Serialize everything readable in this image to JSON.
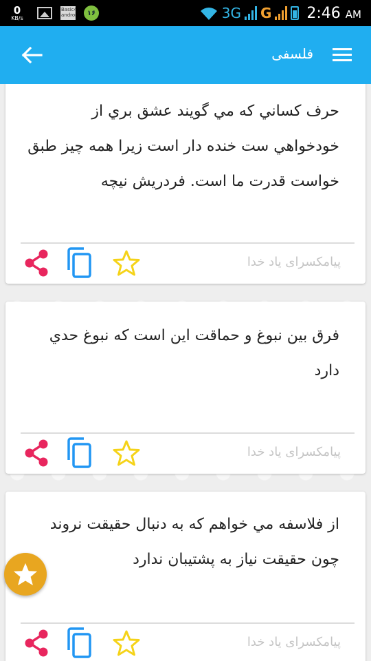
{
  "status_bar": {
    "net_speed_value": "0",
    "net_speed_unit": "KB/s",
    "app_icon_text": "Basic4 android",
    "notification_badge": "۱۶",
    "network_type_1": "3G",
    "network_type_2": "G",
    "time": "2:46",
    "ampm": "AM"
  },
  "app_bar": {
    "title": "فلسفی"
  },
  "colors": {
    "app_bar": "#20aef0",
    "share_icon": "#e8265e",
    "copy_icon": "#2196f3",
    "star_icon": "#f5d319",
    "fab": "#e8a620"
  },
  "cards": [
    {
      "text": "حرف کساني که مي گويند عشق بري از خودخواهي ست خنده دار است زيرا همه چيز طبق خواست قدرت ما است. فردريش نيچه",
      "source": "پیامکسرای یاد خدا"
    },
    {
      "text": "فرق بين نبوغ و حماقت اين است که نبوغ حدي دارد",
      "source": "پیامکسرای یاد خدا"
    },
    {
      "text": "از فلاسفه مي خواهم که به دنبال حقيقت نروند چون حقيقت نياز به پشتيبان ندارد",
      "source": "پیامکسرای یاد خدا"
    }
  ],
  "icons": {
    "back": "arrow-left-icon",
    "menu": "hamburger-menu-icon",
    "share": "share-icon",
    "copy": "copy-icon",
    "favorite": "star-outline-icon",
    "fab": "star-filled-icon"
  }
}
